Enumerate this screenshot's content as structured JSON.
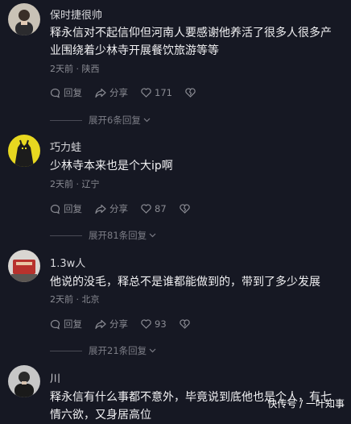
{
  "comments": [
    {
      "username": "保时捷很帅",
      "content": "释永信对不起信仰但河南人要感谢他养活了很多人很多产业围绕着少林寺开展餐饮旅游等等",
      "meta": "2天前 · 陕西",
      "reply_label": "回复",
      "share_label": "分享",
      "likes": "171",
      "expand_label": "展开6条回复"
    },
    {
      "username": "巧力蛙",
      "content": "少林寺本来也是个大ip啊",
      "meta": "2天前 · 辽宁",
      "reply_label": "回复",
      "share_label": "分享",
      "likes": "87",
      "expand_label": "展开81条回复"
    },
    {
      "username": "1.3w人",
      "content": "他说的没毛，释总不是谁都能做到的，带到了多少发展",
      "meta": "2天前 · 北京",
      "reply_label": "回复",
      "share_label": "分享",
      "likes": "93",
      "expand_label": "展开21条回复"
    },
    {
      "username": "川",
      "content": "释永信有什么事都不意外，毕竟说到底他也是个人，有七情六欲，又身居高位"
    }
  ],
  "watermark": "快传号 / 一叶知事",
  "icons": {
    "reply": "reply-bubble-icon",
    "share": "share-arrow-icon",
    "like": "heart-icon",
    "dislike": "broken-heart-icon",
    "expand": "chevron-down-icon"
  }
}
